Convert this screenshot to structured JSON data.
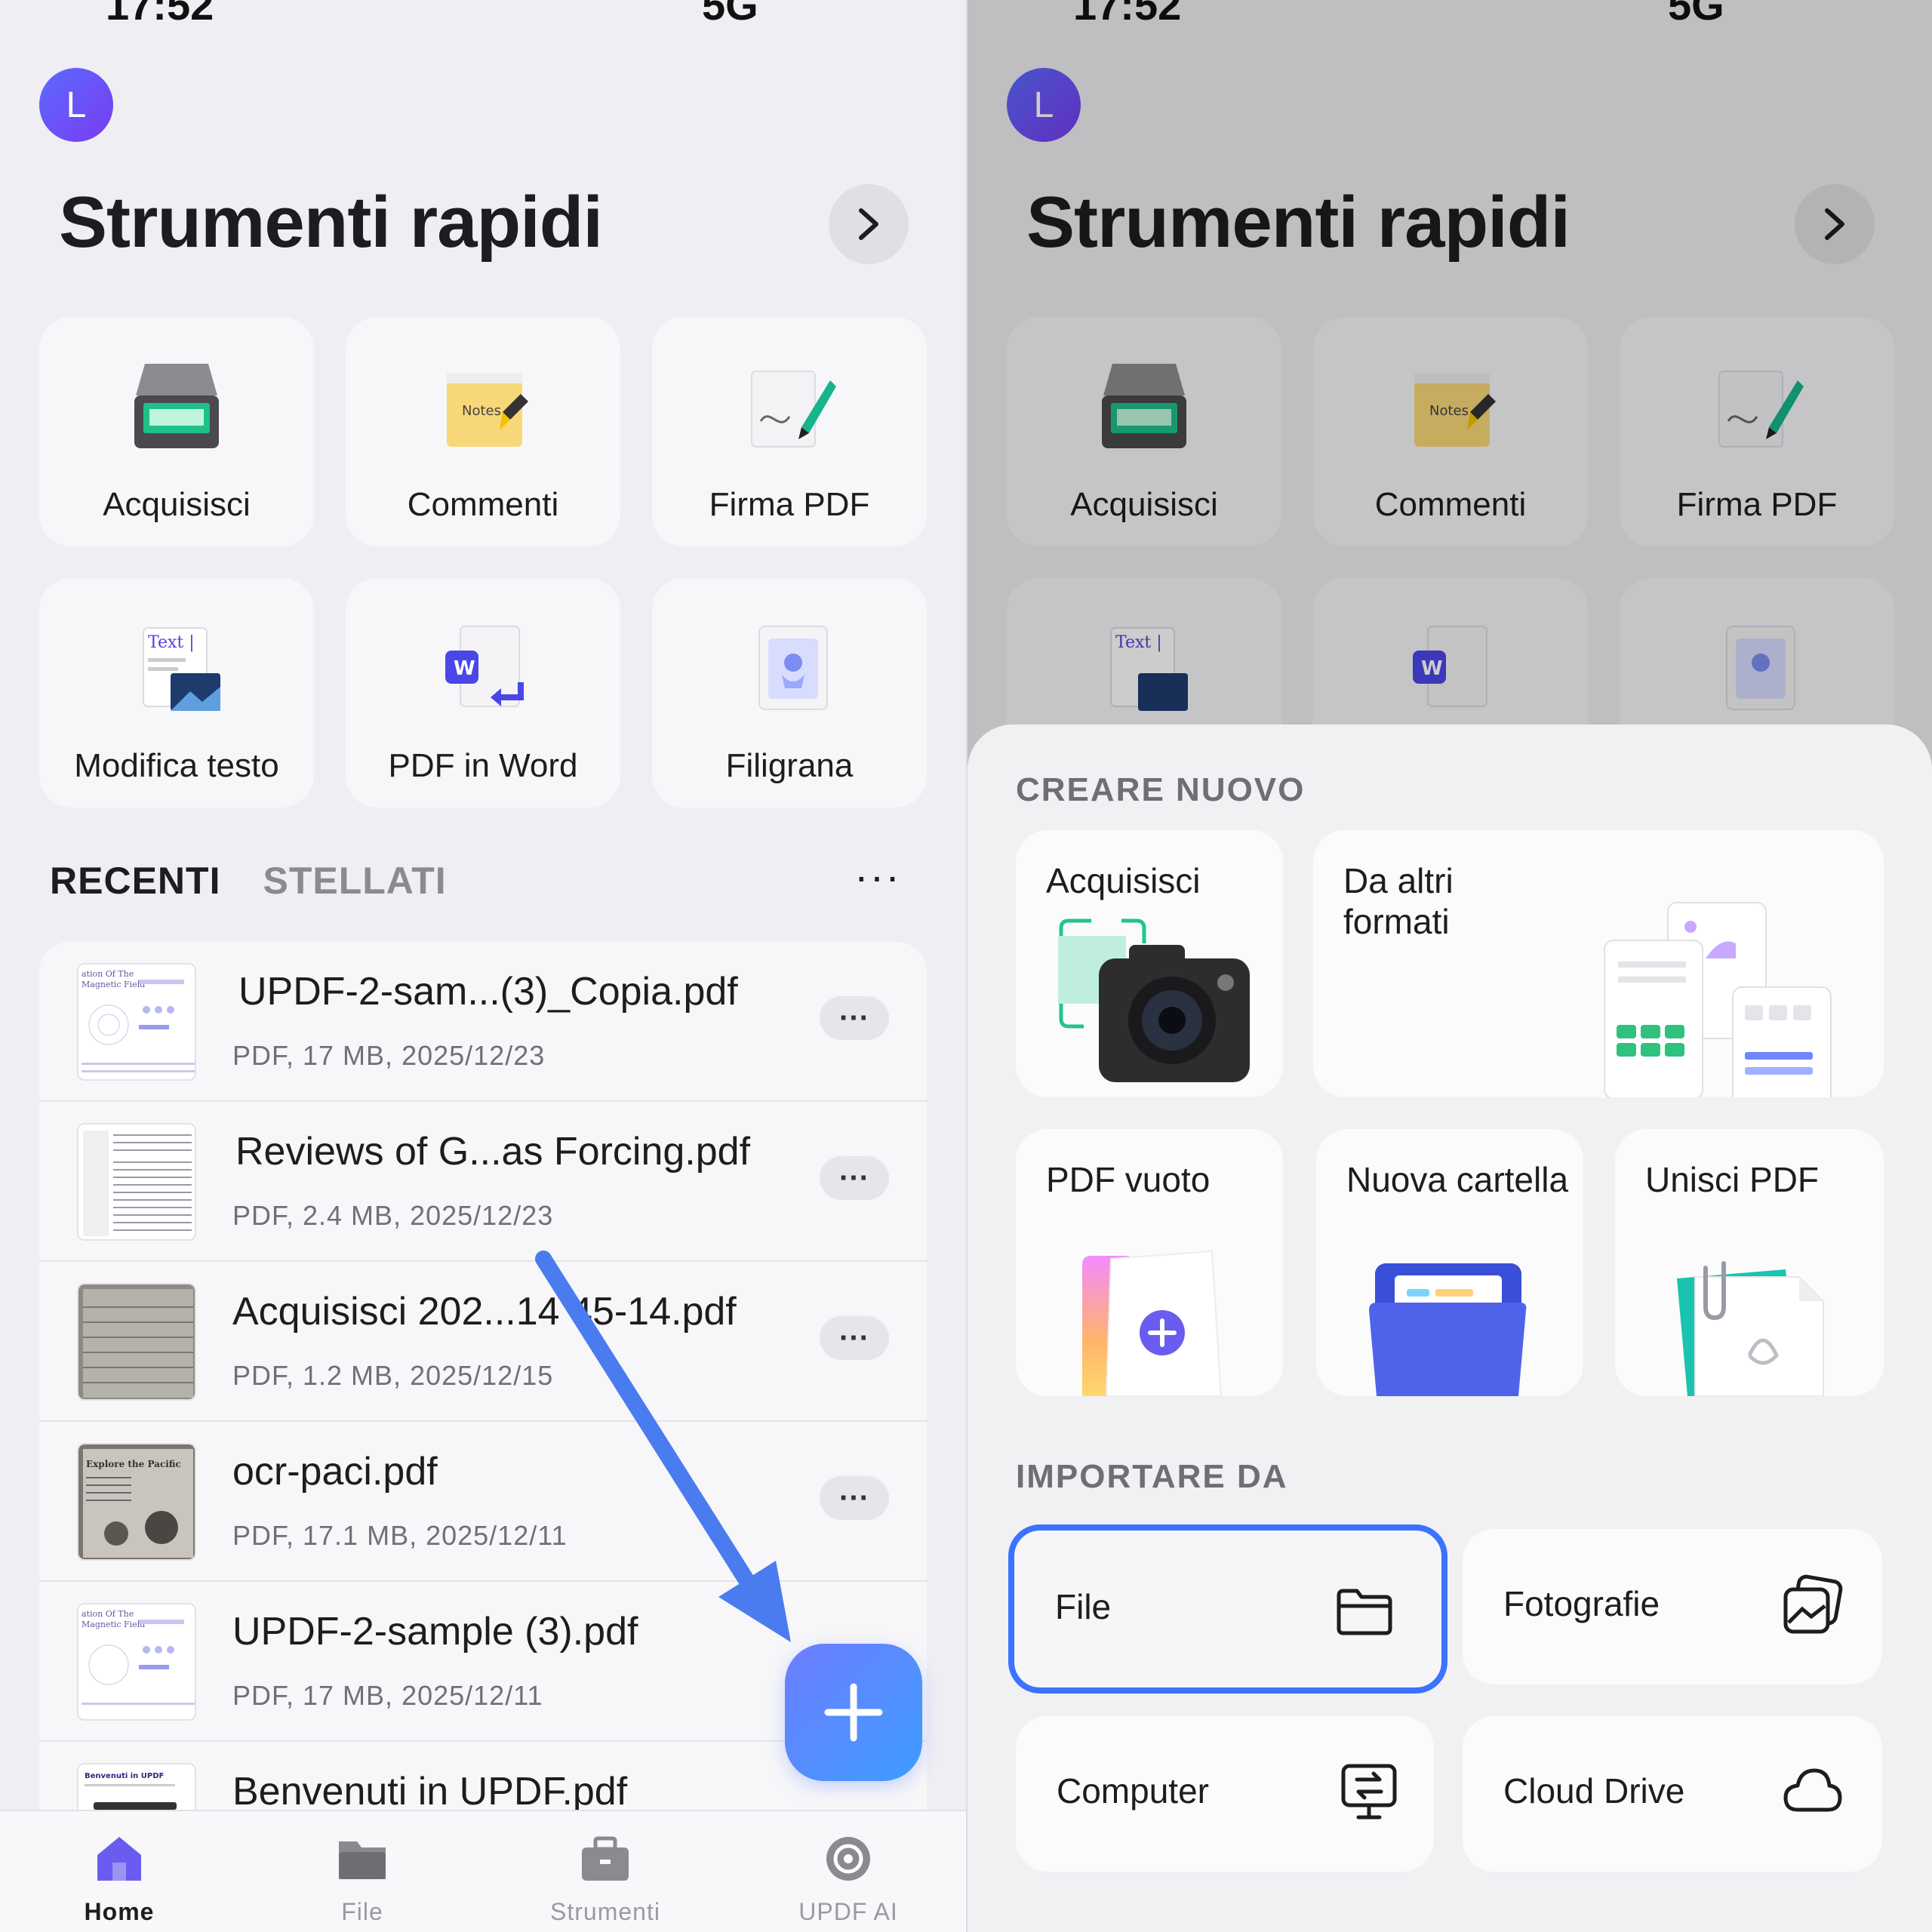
{
  "left": {
    "status": {
      "time": "17:52",
      "signal": "5G"
    },
    "avatar_letter": "L",
    "page_title": "Strumenti rapidi",
    "tools": [
      {
        "label": "Acquisisci",
        "icon": "scanner-icon"
      },
      {
        "label": "Commenti",
        "icon": "notes-icon"
      },
      {
        "label": "Firma PDF",
        "icon": "signature-icon"
      },
      {
        "label": "Modifica testo",
        "icon": "edit-text-icon"
      },
      {
        "label": "PDF in Word",
        "icon": "word-convert-icon"
      },
      {
        "label": "Filigrana",
        "icon": "watermark-icon"
      }
    ],
    "tabs": {
      "recent": "RECENTI",
      "starred": "STELLATI"
    },
    "more_label": "···",
    "files": [
      {
        "name": "UPDF-2-sam...(3)_Copia.pdf",
        "meta": "PDF, 17 MB, 2025/12/23"
      },
      {
        "name": "Reviews of G...as Forcing.pdf",
        "meta": "PDF, 2.4 MB, 2025/12/23"
      },
      {
        "name": "Acquisisci 202...14 45-14.pdf",
        "meta": "PDF, 1.2 MB, 2025/12/15"
      },
      {
        "name": "ocr-paci.pdf",
        "meta": "PDF, 17.1 MB, 2025/12/11"
      },
      {
        "name": "UPDF-2-sample (3).pdf",
        "meta": "PDF, 17 MB, 2025/12/11"
      },
      {
        "name": "Benvenuti in UPDF.pdf",
        "meta": ""
      }
    ],
    "row_menu_label": "···",
    "tabbar": [
      {
        "label": "Home",
        "icon": "home-icon"
      },
      {
        "label": "File",
        "icon": "folder-icon"
      },
      {
        "label": "Strumenti",
        "icon": "toolbox-icon"
      },
      {
        "label": "UPDF AI",
        "icon": "ai-icon"
      }
    ]
  },
  "right": {
    "status": {
      "time": "17:52",
      "signal": "5G"
    },
    "avatar_letter": "L",
    "page_title": "Strumenti rapidi",
    "tools": [
      {
        "label": "Acquisisci"
      },
      {
        "label": "Commenti"
      },
      {
        "label": "Firma PDF"
      }
    ],
    "create_title": "CREARE NUOVO",
    "create": {
      "scan": "Acquisisci",
      "other_formats": "Da altri formati",
      "blank_pdf": "PDF vuoto",
      "new_folder": "Nuova cartella",
      "merge_pdf": "Unisci PDF"
    },
    "import_title": "IMPORTARE DA",
    "import": {
      "file": "File",
      "photos": "Fotografie",
      "computer": "Computer",
      "cloud": "Cloud Drive"
    }
  },
  "colors": {
    "accent": "#3b72ff",
    "fab_start": "#6f7dff",
    "fab_end": "#3c9dff",
    "arrow": "#4a7cf0",
    "avatar": "#5b4ef0"
  }
}
